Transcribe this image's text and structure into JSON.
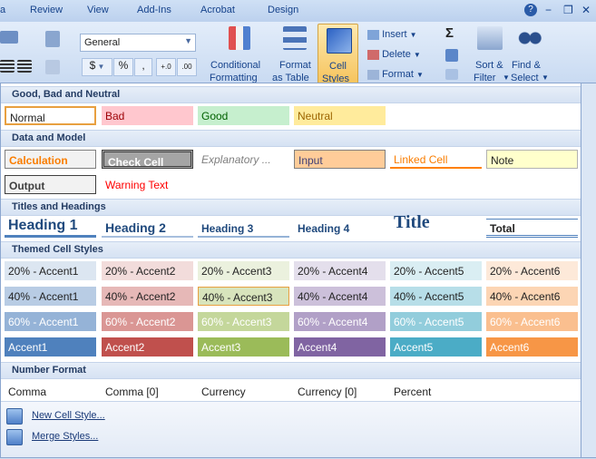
{
  "menu": {
    "tabs": [
      "Review",
      "View",
      "Add-Ins",
      "Acrobat",
      "Design"
    ],
    "help_icon": "help-icon",
    "window_controls": [
      "minimize-icon",
      "restore-icon",
      "close-icon"
    ]
  },
  "ribbon": {
    "number_format": "General",
    "currency_symbol": "$",
    "percent_symbol": "%",
    "comma_symbol": ",",
    "increase_decimal": "+.0",
    "decrease_decimal": ".00",
    "conditional_formatting": [
      "Conditional",
      "Formatting"
    ],
    "format_as_table": [
      "Format",
      "as Table"
    ],
    "cell_styles": [
      "Cell",
      "Styles"
    ],
    "insert_label": "Insert",
    "delete_label": "Delete",
    "format_label": "Format",
    "autosum_symbol": "Σ",
    "sort_filter": [
      "Sort &",
      "Filter"
    ],
    "find_select": [
      "Find &",
      "Select"
    ]
  },
  "gallery": {
    "sections": {
      "good_bad_neutral": "Good, Bad and Neutral",
      "data_model": "Data and Model",
      "titles_headings": "Titles and Headings",
      "themed": "Themed Cell Styles",
      "number_format": "Number Format"
    },
    "good_bad_neutral": [
      "Normal",
      "Bad",
      "Good",
      "Neutral"
    ],
    "data_model_row1": [
      "Calculation",
      "Check Cell",
      "Explanatory ...",
      "Input",
      "Linked Cell",
      "Note"
    ],
    "data_model_row2": [
      "Output",
      "Warning Text"
    ],
    "titles": [
      "Heading 1",
      "Heading 2",
      "Heading 3",
      "Heading 4",
      "Title",
      "Total"
    ],
    "themed_20": [
      "20% - Accent1",
      "20% - Accent2",
      "20% - Accent3",
      "20% - Accent4",
      "20% - Accent5",
      "20% - Accent6"
    ],
    "themed_40": [
      "40% - Accent1",
      "40% - Accent2",
      "40% - Accent3",
      "40% - Accent4",
      "40% - Accent5",
      "40% - Accent6"
    ],
    "themed_60": [
      "60% - Accent1",
      "60% - Accent2",
      "60% - Accent3",
      "60% - Accent4",
      "60% - Accent5",
      "60% - Accent6"
    ],
    "themed_100": [
      "Accent1",
      "Accent2",
      "Accent3",
      "Accent4",
      "Accent5",
      "Accent6"
    ],
    "number": [
      "Comma",
      "Comma [0]",
      "Currency",
      "Currency [0]",
      "Percent"
    ],
    "footer": [
      "New Cell Style...",
      "Merge Styles..."
    ]
  }
}
